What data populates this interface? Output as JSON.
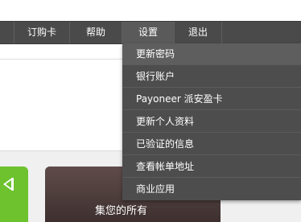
{
  "nav": {
    "items": [
      {
        "label": "订购卡"
      },
      {
        "label": "帮助"
      },
      {
        "label": "设置"
      },
      {
        "label": "退出"
      }
    ]
  },
  "settings_menu": {
    "items": [
      {
        "label": "更新密码"
      },
      {
        "label": "银行账户"
      },
      {
        "label": "Payoneer 派安盈卡"
      },
      {
        "label": "更新个人资料"
      },
      {
        "label": "已验证的信息"
      },
      {
        "label": "查看帐单地址"
      },
      {
        "label": "商业应用"
      }
    ]
  },
  "promo": {
    "caption": "集您的所有"
  },
  "colors": {
    "navbar": "#4a4a4a",
    "dropdown": "#4d4d4d",
    "accent_green": "#6dc22e"
  }
}
